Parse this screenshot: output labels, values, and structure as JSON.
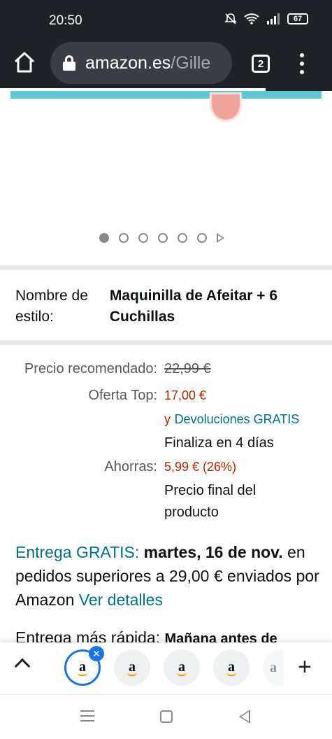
{
  "status_bar": {
    "time": "20:50",
    "battery": "67",
    "icons": [
      "mute-bell-icon",
      "wifi-icon",
      "signal-icon"
    ]
  },
  "browser": {
    "url_host": "amazon.es",
    "url_path": "/Gille",
    "tab_count": "2",
    "icons": [
      "home-icon",
      "lock-icon",
      "tabs-icon",
      "overflow-menu-icon"
    ]
  },
  "carousel": {
    "image_count": 6,
    "current_index": 0
  },
  "style": {
    "label": "Nombre de estilo:",
    "value": "Maquinilla de Afeitar + 6 Cuchillas"
  },
  "price": {
    "recommended_label": "Precio recomendado:",
    "recommended_value": "22,99 €",
    "offer_label": "Oferta Top:",
    "offer_value": "17,00 €",
    "returns_prefix": "y",
    "returns_link": "Devoluciones GRATIS",
    "ends_text": "Finaliza en 4 días",
    "savings_label": "Ahorras:",
    "savings_value": "5,99 € (26%)",
    "final_text": "Precio final del producto"
  },
  "delivery": {
    "free_label": "Entrega GRATIS:",
    "date": "martes, 16 de nov.",
    "condition": "en pedidos superiores a 29,00 €",
    "shipped_by": "enviados por Amazon",
    "details_link": "Ver detalles"
  },
  "faster_delivery": {
    "label": "Entrega más rápida:",
    "value": "Mañana antes de"
  },
  "tab_strip": {
    "favicon_letter": "a",
    "colors": {
      "active_ring": "#1a73e8",
      "smile": "#ff9900"
    }
  },
  "colors": {
    "link": "#007185",
    "price_red": "#b12704",
    "chrome_bg": "#1f2127"
  }
}
